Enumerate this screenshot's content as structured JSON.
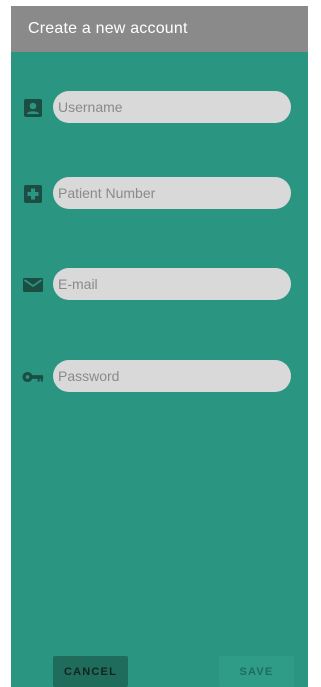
{
  "appbar": {
    "title": "Create a new account"
  },
  "form": {
    "username": {
      "placeholder": "Username",
      "icon": "account-box-icon"
    },
    "patient_number": {
      "placeholder": "Patient Number",
      "icon": "medical-plus-icon"
    },
    "email": {
      "placeholder": "E-mail",
      "icon": "envelope-icon"
    },
    "password": {
      "placeholder": "Password",
      "icon": "key-icon"
    }
  },
  "actions": {
    "cancel_label": "CANCEL",
    "save_label": "SAVE"
  },
  "colors": {
    "background": "#2a9580",
    "appbar": "#8a8a8a",
    "field": "#d9d9d9",
    "icon": "#1b4d43",
    "cancel_button": "#1f6b5c",
    "save_button": "#2f9c87"
  }
}
